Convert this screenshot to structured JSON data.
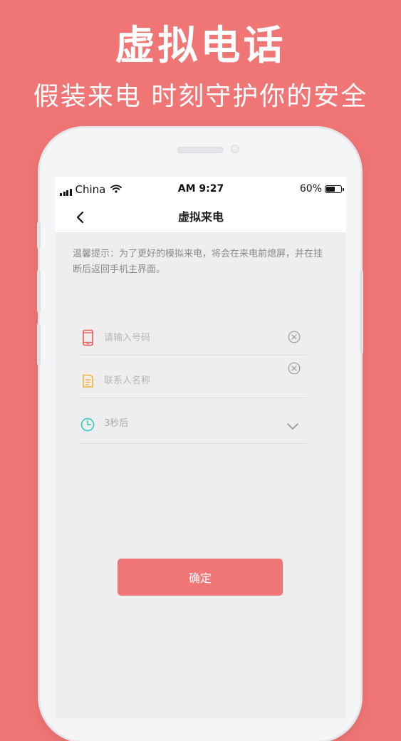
{
  "promo": {
    "title": "虚拟电话",
    "subtitle": "假装来电 时刻守护你的安全"
  },
  "status_bar": {
    "carrier": "China",
    "time": "AM 9:27",
    "battery_percent": "60%",
    "battery_level": 0.6
  },
  "nav": {
    "back_icon": "chevron-left-icon",
    "title": "虚拟来电"
  },
  "tip": {
    "text": "温馨提示：为了更好的模拟来电，将会在来电前熄屏，并在挂断后返回手机主界面。"
  },
  "form": {
    "phone": {
      "icon": "mobile-phone-icon",
      "placeholder": "请输入号码",
      "value": ""
    },
    "contact_name": {
      "icon": "contact-card-icon",
      "placeholder": "联系人名称",
      "value": ""
    },
    "delay": {
      "icon": "clock-icon",
      "value": "3秒后"
    }
  },
  "confirm": {
    "label": "确定"
  },
  "colors": {
    "accent": "#f07675",
    "phone_icon": "#ee5a5a",
    "contact_icon": "#f4b13a",
    "clock_icon": "#3fcbc0"
  }
}
